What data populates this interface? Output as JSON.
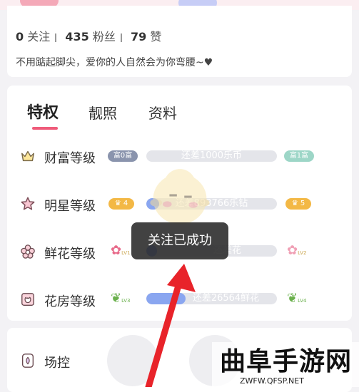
{
  "profile": {
    "follow_count": "0",
    "follow_label": "关注",
    "fans_count": "435",
    "fans_label": "粉丝",
    "likes_count": "79",
    "likes_label": "赞",
    "motto": "不用踮起脚尖，爱你的人自然会为你弯腰~♥"
  },
  "tabs": [
    {
      "label": "特权",
      "active": true
    },
    {
      "label": "靓照",
      "active": false
    },
    {
      "label": "资料",
      "active": false
    }
  ],
  "levels": [
    {
      "icon": "crown-icon",
      "label": "财富等级",
      "current_badge": "富0富",
      "next_badge": "富1富",
      "progress_text": "还差1000乐币",
      "progress": 0.0
    },
    {
      "icon": "star-icon",
      "label": "明星等级",
      "current_badge": "4",
      "next_badge": "5",
      "progress_text": "还差893766乐钻",
      "progress": 0.1
    },
    {
      "icon": "flower-icon",
      "label": "鲜花等级",
      "current_badge": "LV1",
      "next_badge": "LV2",
      "progress_text": "还差花",
      "progress": 0.08
    },
    {
      "icon": "greenhouse-icon",
      "label": "花房等级",
      "current_badge": "LV3",
      "next_badge": "LV4",
      "progress_text": "还差26564鲜花",
      "progress": 0.3
    }
  ],
  "control": {
    "label": "场控"
  },
  "toast": {
    "message": "关注已成功"
  },
  "watermark": {
    "title": "曲阜手游网",
    "url": "ZWFW.QFSP.NET"
  },
  "colors": {
    "accent": "#ef5b7a",
    "progress_fill": "#8aa6f0",
    "toast_bg": "#282828",
    "arrow": "#e8232a"
  }
}
